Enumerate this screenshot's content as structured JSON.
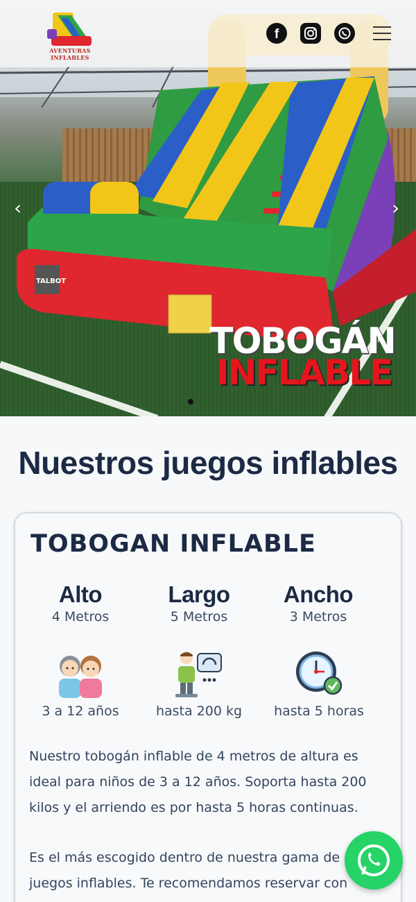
{
  "brand": {
    "logo_text": "AVENTURAS INFLABLES",
    "accent": "#c2241c"
  },
  "header": {
    "social": [
      {
        "name": "facebook-icon"
      },
      {
        "name": "instagram-icon"
      },
      {
        "name": "whatsapp-icon"
      }
    ],
    "menu_icon": "hamburger-menu-icon"
  },
  "hero": {
    "title_line1": "TOBOGÁN",
    "title_line2": "INFLABLE",
    "badge_text": "TALBOT",
    "prev_arrow": "‹",
    "next_arrow": "›",
    "slides_dots": 1
  },
  "section": {
    "title": "Nuestros juegos inflables"
  },
  "product": {
    "name": "TOBOGAN INFLABLE",
    "specs": [
      {
        "label": "Alto",
        "value": "4 Metros"
      },
      {
        "label": "Largo",
        "value": "5 Metros"
      },
      {
        "label": "Ancho",
        "value": "3 Metros"
      }
    ],
    "features": [
      {
        "icon": "children-icon",
        "text": "3 a 12 años"
      },
      {
        "icon": "weight-scale-icon",
        "text": "hasta 200  kg"
      },
      {
        "icon": "clock-check-icon",
        "text": "hasta 5 horas"
      }
    ],
    "description_1": "Nuestro tobogán inflable de 4 metros de altura es ideal para niños de 3 a 12 años. Soporta hasta 200 kilos y el arriendo es por hasta 5 horas continuas.",
    "description_2": "Es el más escogido dentro de nuestra gama de juegos inflables. Te recomendamos reservar con"
  },
  "colors": {
    "heading": "#1c2a44",
    "text": "#33445c",
    "whatsapp": "#25d366"
  }
}
